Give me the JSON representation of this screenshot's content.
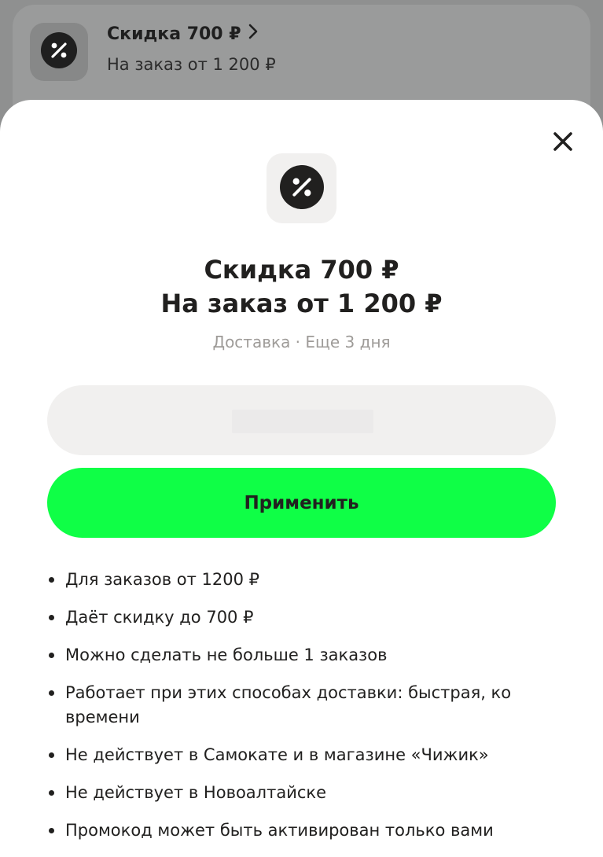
{
  "background_card": {
    "title": "Скидка 700 ₽",
    "subtitle": "На заказ от 1 200 ₽",
    "icon": "percent-icon",
    "chevron_icon": "chevron-right-icon"
  },
  "sheet": {
    "close_icon": "close-icon",
    "icon": "percent-icon",
    "title": "Скидка 700 ₽",
    "subtitle": "На заказ от 1 200 ₽",
    "meta": "Доставка · Еще 3 дня",
    "promo_input": {
      "value": "",
      "placeholder": ""
    },
    "apply_label": "Применить",
    "conditions": [
      "Для заказов от 1200 ₽",
      "Даёт скидку до 700 ₽",
      "Можно сделать не больше 1 заказов",
      "Работает при этих способах доставки: быстрая, ко времени",
      "Не действует в Самокате и в магазине «Чижик»",
      "Не действует в Новоалтайске",
      "Промокод может быть активирован только вами"
    ]
  },
  "colors": {
    "accent": "#0fff46",
    "text_primary": "#21201f",
    "text_secondary": "#9e9b98",
    "tile_background": "#f1f0ef",
    "overlay": "#8f9090"
  }
}
